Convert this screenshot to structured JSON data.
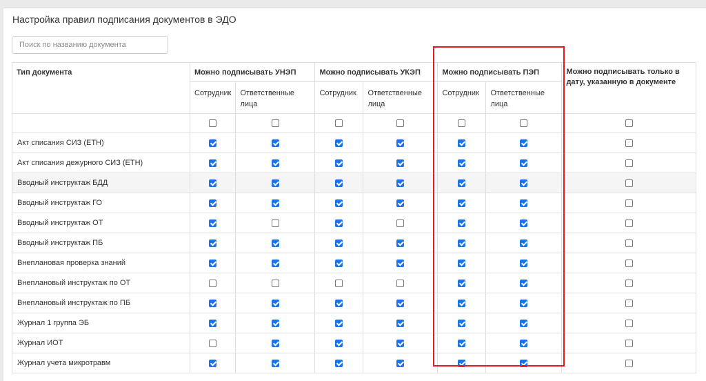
{
  "page": {
    "title": "Настройка правил подписания документов в ЭДО",
    "search_placeholder": "Поиск по названию документа"
  },
  "table": {
    "col_doc": "Тип документа",
    "groups": [
      "Можно подписывать УНЭП",
      "Можно подписывать УКЭП",
      "Можно подписывать ПЭП"
    ],
    "col_last": "Можно подписывать только в дату, указанную в документе",
    "sub_employee": "Сотрудник",
    "sub_responsible": "Ответственные лица",
    "filter_row": [
      false,
      false,
      false,
      false,
      false,
      false,
      false
    ],
    "rows": [
      {
        "name": "Акт списания СИЗ (ЕТН)",
        "checks": [
          true,
          true,
          true,
          true,
          true,
          true,
          false
        ]
      },
      {
        "name": "Акт списания дежурного СИЗ (ЕТН)",
        "checks": [
          true,
          true,
          true,
          true,
          true,
          true,
          false
        ]
      },
      {
        "name": "Вводный инструктаж БДД",
        "checks": [
          true,
          true,
          true,
          true,
          true,
          true,
          false
        ]
      },
      {
        "name": "Вводный инструктаж ГО",
        "checks": [
          true,
          true,
          true,
          true,
          true,
          true,
          false
        ]
      },
      {
        "name": "Вводный инструктаж ОТ",
        "checks": [
          true,
          false,
          true,
          false,
          true,
          true,
          false
        ]
      },
      {
        "name": "Вводный инструктаж ПБ",
        "checks": [
          true,
          true,
          true,
          true,
          true,
          true,
          false
        ]
      },
      {
        "name": "Внеплановая проверка знаний",
        "checks": [
          true,
          true,
          true,
          true,
          true,
          true,
          false
        ]
      },
      {
        "name": "Внеплановый инструктаж по ОТ",
        "checks": [
          false,
          false,
          false,
          false,
          true,
          true,
          false
        ]
      },
      {
        "name": "Внеплановый инструктаж по ПБ",
        "checks": [
          true,
          true,
          true,
          true,
          true,
          true,
          false
        ]
      },
      {
        "name": "Журнал 1 группа ЭБ",
        "checks": [
          true,
          true,
          true,
          true,
          true,
          true,
          false
        ]
      },
      {
        "name": "Журнал ИОТ",
        "checks": [
          false,
          true,
          true,
          true,
          true,
          true,
          false
        ]
      },
      {
        "name": "Журнал учета микротравм",
        "checks": [
          true,
          true,
          true,
          true,
          true,
          true,
          false
        ]
      }
    ]
  },
  "colors": {
    "checkbox_checked": "#1a73e8",
    "highlight_border": "#e11b22"
  }
}
